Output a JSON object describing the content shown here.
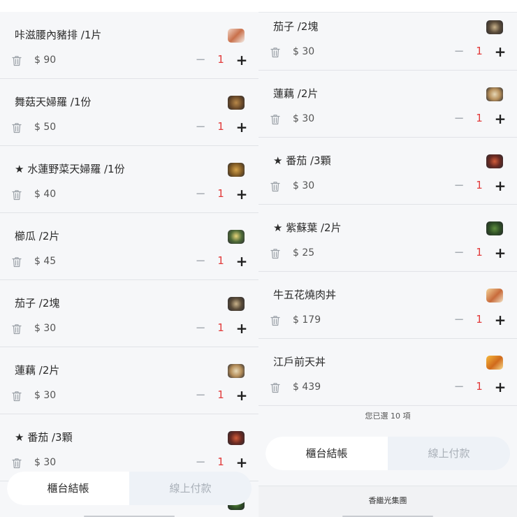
{
  "currency": "$",
  "left": {
    "items": [
      {
        "name": "咔滋腰內豬排 /1片",
        "price": "90",
        "qty": "1"
      },
      {
        "name": "舞菇天婦羅 /1份",
        "price": "50",
        "qty": "1"
      },
      {
        "name": "★ 水蓮野菜天婦羅 /1份",
        "price": "40",
        "qty": "1"
      },
      {
        "name": "櫛瓜 /2片",
        "price": "45",
        "qty": "1"
      },
      {
        "name": "茄子 /2塊",
        "price": "30",
        "qty": "1"
      },
      {
        "name": "蓮藕 /2片",
        "price": "30",
        "qty": "1"
      },
      {
        "name": "★ 番茄 /3顆",
        "price": "30",
        "qty": "1"
      }
    ],
    "pay": {
      "counter": "櫃台結帳",
      "online": "線上付款"
    }
  },
  "right": {
    "items": [
      {
        "name": "茄子 /2塊",
        "price": "30",
        "qty": "1"
      },
      {
        "name": "蓮藕 /2片",
        "price": "30",
        "qty": "1"
      },
      {
        "name": "★ 番茄 /3顆",
        "price": "30",
        "qty": "1"
      },
      {
        "name": "★ 紫蘇葉 /2片",
        "price": "25",
        "qty": "1"
      },
      {
        "name": "牛五花燒肉丼",
        "price": "179",
        "qty": "1"
      },
      {
        "name": "江戶前天丼",
        "price": "439",
        "qty": "1"
      }
    ],
    "selected_text": "您已選 10 項",
    "pay": {
      "counter": "櫃台結帳",
      "online": "線上付款"
    },
    "footer": "香繼光集團"
  },
  "icons": {
    "trash": "trash-icon",
    "minus": "minus-icon",
    "plus": "plus-icon"
  },
  "colors": {
    "accent_qty": "#e23b3b",
    "background": "#f6f7f9"
  }
}
